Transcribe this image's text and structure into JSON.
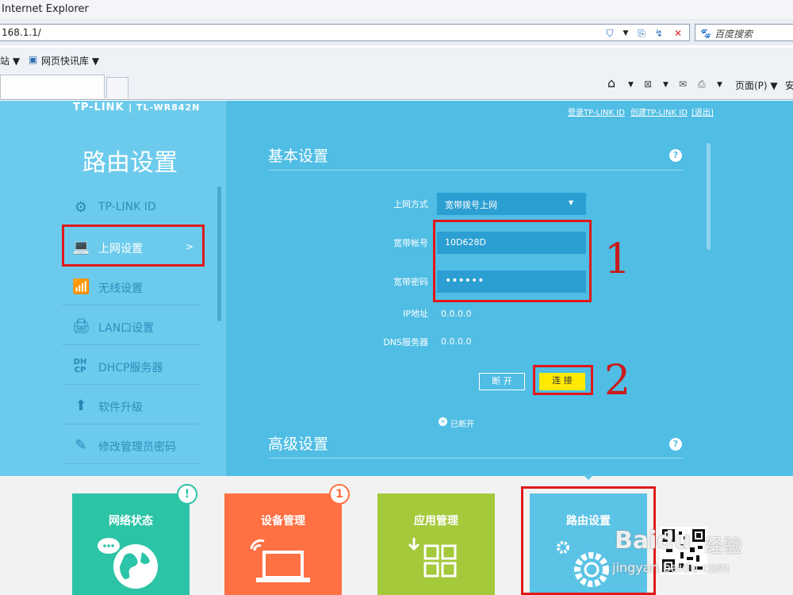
{
  "browser": {
    "title": "Internet Explorer",
    "url": "168.1.1/",
    "search_placeholder": "百度搜索",
    "fav_item1": "站 ▼",
    "fav_item2": "网页快讯库 ▼",
    "page_menu": "页面(P) ▼",
    "safety_menu": "安"
  },
  "router": {
    "logo": "TP-LINK",
    "model": "| TL-WR842N",
    "links": [
      "登录TP-LINK ID",
      "创建TP-LINK ID",
      "[退出]"
    ],
    "sidebar_title": "路由设置",
    "sidebar_items": [
      {
        "label": "TP-LINK ID",
        "icon": "gear-icon"
      },
      {
        "label": "上网设置",
        "icon": "laptop-icon",
        "arrow": ">"
      },
      {
        "label": "无线设置",
        "icon": "wifi-icon"
      },
      {
        "label": "LAN口设置",
        "icon": "router-icon"
      },
      {
        "label": "DHCP服务器",
        "icon": "dhcp-icon",
        "icon_text": "DH CP"
      },
      {
        "label": "软件升级",
        "icon": "upload-icon"
      },
      {
        "label": "修改管理员密码",
        "icon": "pencil-icon"
      }
    ],
    "basic": {
      "title": "基本设置",
      "help": "?",
      "wan_type_label": "上网方式",
      "wan_type_value": "宽带拨号上网",
      "account_label": "宽带帐号",
      "account_value": "10D628D",
      "password_label": "宽带密码",
      "password_value": "••••••",
      "ip_label": "IP地址",
      "ip_value": "0.0.0.0",
      "dns_label": "DNS服务器",
      "dns_value": "0.0.0.0",
      "disconnect_label": "断 开",
      "connect_label": "连 接",
      "status_text": "已断开"
    },
    "advanced": {
      "title": "高级设置",
      "help": "?"
    },
    "annotations": [
      "1",
      "2"
    ]
  },
  "tiles": [
    {
      "label": "网络状态",
      "color": "#2cc4a6",
      "badge": "!",
      "badge_color": "#2cc4a6"
    },
    {
      "label": "设备管理",
      "color": "#ff7043",
      "badge": "1",
      "badge_color": "#ff7043"
    },
    {
      "label": "应用管理",
      "color": "#a4c93a"
    },
    {
      "label": "路由设置",
      "color": "#5bc3e6"
    }
  ],
  "watermark": {
    "brand": "Bai",
    "paw": "du",
    "sub": "经验",
    "domain": "jingyan.baidu.com"
  },
  "colors": {
    "accent": "#4fbde4",
    "annotation_red": "#e01818",
    "connect_yellow": "#ffea00"
  }
}
